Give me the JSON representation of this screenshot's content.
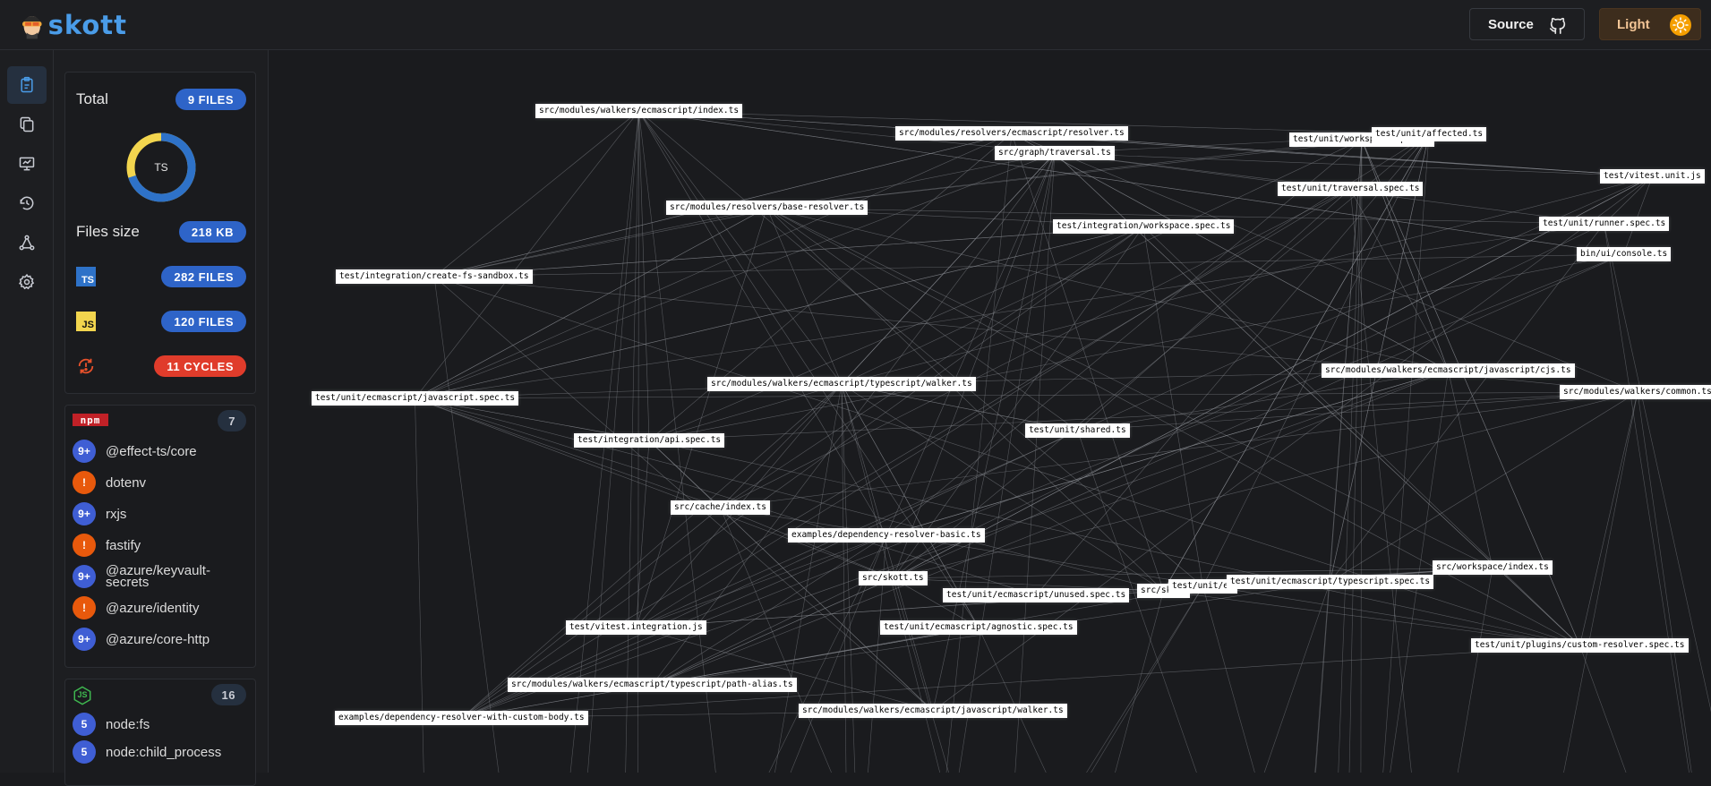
{
  "header": {
    "logo_text": "skott",
    "source_label": "Source",
    "theme_label": "Light"
  },
  "rail": {
    "items": [
      {
        "icon": "clipboard-icon"
      },
      {
        "icon": "files-icon"
      },
      {
        "icon": "presentation-icon"
      },
      {
        "icon": "cycle-history-icon"
      },
      {
        "icon": "graph-nodes-icon"
      },
      {
        "icon": "gear-icon"
      }
    ]
  },
  "summary": {
    "total_label": "Total",
    "total_badge": "9 FILES",
    "donut_label": "TS",
    "donut_fraction_ts": 0.7,
    "files_size_label": "Files size",
    "files_size_badge": "218 KB",
    "ts_icon_text": "TS",
    "ts_badge": "282 FILES",
    "js_icon_text": "JS",
    "js_badge": "120 FILES",
    "cycles_badge": "11 CYCLES",
    "colors": {
      "ts": "#2e72c8",
      "js": "#f2d54e",
      "accent_blue": "#2e64c8",
      "cycles_red": "#e03c2b"
    }
  },
  "npm": {
    "logo_text": "npm",
    "count": "7",
    "items": [
      {
        "badge": "9+",
        "kind": "blue",
        "name": "@effect-ts/core"
      },
      {
        "badge": "!",
        "kind": "orange",
        "name": "dotenv"
      },
      {
        "badge": "9+",
        "kind": "blue",
        "name": "rxjs"
      },
      {
        "badge": "!",
        "kind": "orange",
        "name": "fastify"
      },
      {
        "badge": "9+",
        "kind": "blue",
        "name": "@azure/keyvault-secrets"
      },
      {
        "badge": "!",
        "kind": "orange",
        "name": "@azure/identity"
      },
      {
        "badge": "9+",
        "kind": "blue",
        "name": "@azure/core-http"
      }
    ]
  },
  "builtin": {
    "logo_text": "JS",
    "count": "16",
    "items": [
      {
        "badge": "5",
        "kind": "blue",
        "name": "node:fs"
      },
      {
        "badge": "5",
        "kind": "blue",
        "name": "node:child_process"
      }
    ]
  },
  "graph": {
    "nodes": [
      {
        "id": "n1",
        "label": "src/modules/walkers/ecmascript/index.ts"
      },
      {
        "id": "n2",
        "label": "src/modules/resolvers/ecmascript/resolver.ts"
      },
      {
        "id": "n3",
        "label": "src/graph/traversal.ts"
      },
      {
        "id": "n4",
        "label": "test/unit/workspace.spec.ts"
      },
      {
        "id": "n5",
        "label": "test/unit/affected.ts"
      },
      {
        "id": "n6",
        "label": "test/vitest.unit.js"
      },
      {
        "id": "n7",
        "label": "test/unit/traversal.spec.ts"
      },
      {
        "id": "n8",
        "label": "src/modules/resolvers/base-resolver.ts"
      },
      {
        "id": "n9",
        "label": "test/integration/workspace.spec.ts"
      },
      {
        "id": "n10",
        "label": "test/unit/runner.spec.ts"
      },
      {
        "id": "n11",
        "label": "bin/ui/console.ts"
      },
      {
        "id": "n12",
        "label": "test/integration/create-fs-sandbox.ts"
      },
      {
        "id": "n13",
        "label": "src/modules/walkers/ecmascript/javascript/cjs.ts"
      },
      {
        "id": "n14",
        "label": "src/modules/walkers/common.ts"
      },
      {
        "id": "n15",
        "label": "src/modules/walkers/ecmascript/typescript/walker.ts"
      },
      {
        "id": "n16",
        "label": "test/unit/ecmascript/javascript.spec.ts"
      },
      {
        "id": "n17",
        "label": "test/unit/shared.ts"
      },
      {
        "id": "n18",
        "label": "test/integration/api.spec.ts"
      },
      {
        "id": "n19",
        "label": "src/cache/index.ts"
      },
      {
        "id": "n20",
        "label": "examples/dependency-resolver-basic.ts"
      },
      {
        "id": "n21",
        "label": "src/workspace/index.ts"
      },
      {
        "id": "n22",
        "label": "src/skott.ts"
      },
      {
        "id": "n23",
        "label": "test/unit/ecmascript/unused.spec.ts"
      },
      {
        "id": "n24",
        "label": "src/skott"
      },
      {
        "id": "n25",
        "label": "test/unit/ec"
      },
      {
        "id": "n26",
        "label": "test/unit/ecmascript/typescript.spec.ts"
      },
      {
        "id": "n27",
        "label": "test/vitest.integration.js"
      },
      {
        "id": "n28",
        "label": "test/unit/ecmascript/agnostic.spec.ts"
      },
      {
        "id": "n29",
        "label": "test/unit/plugins/custom-resolver.spec.ts"
      },
      {
        "id": "n30",
        "label": "src/modules/walkers/ecmascript/typescript/path-alias.ts"
      },
      {
        "id": "n31",
        "label": "examples/dependency-resolver-with-custom-body.ts"
      },
      {
        "id": "n32",
        "label": "src/modules/walkers/ecmascript/javascript/walker.ts"
      }
    ]
  }
}
